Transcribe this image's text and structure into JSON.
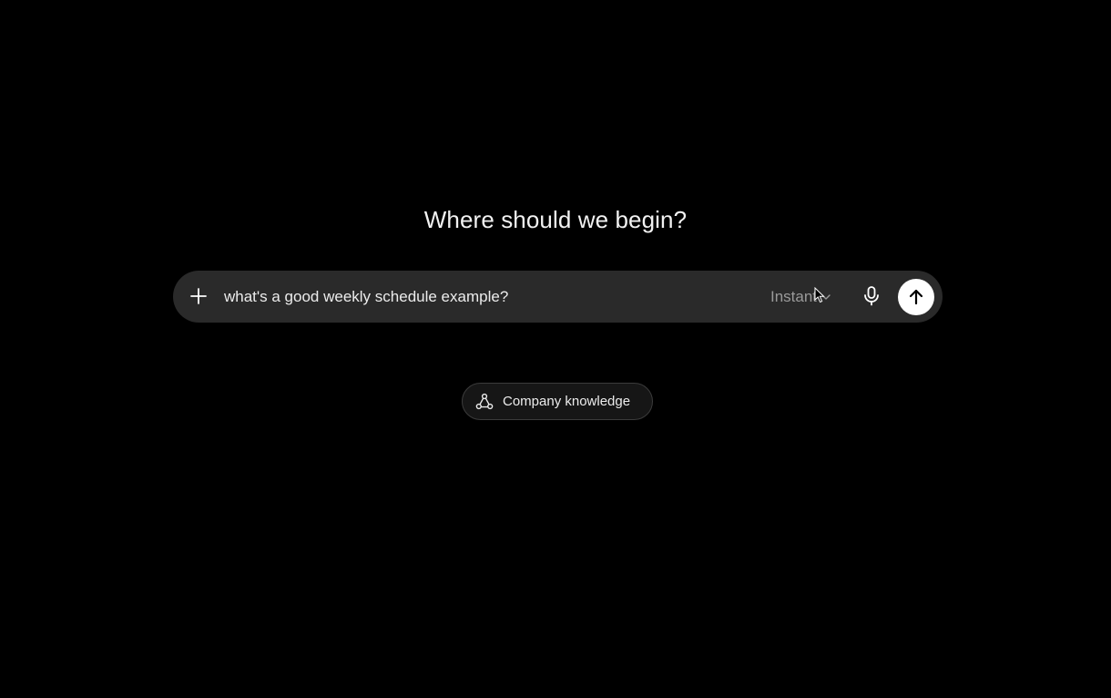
{
  "heading": "Where should we begin?",
  "composer": {
    "input_value": "what's a good weekly schedule example?",
    "model_label": "Instant",
    "icons": {
      "attach": "plus-icon",
      "model_dropdown": "chevron-down-icon",
      "voice": "microphone-icon",
      "send": "arrow-up-icon"
    }
  },
  "chips": [
    {
      "label": "Company knowledge",
      "icon": "connected-nodes-icon"
    }
  ],
  "colors": {
    "background": "#000000",
    "composer": "#2a2a2a",
    "send_button": "#ffffff",
    "muted_text": "#9a9a9a"
  }
}
